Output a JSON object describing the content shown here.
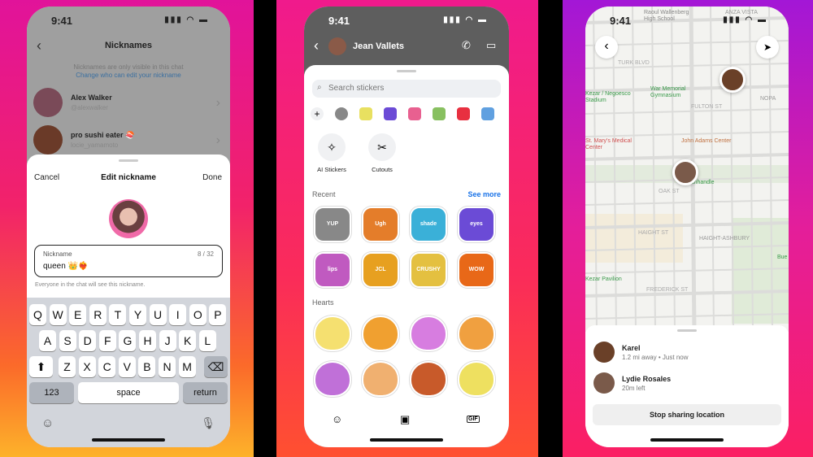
{
  "status": {
    "time": "9:41"
  },
  "nicknames": {
    "title": "Nicknames",
    "info_line": "Nicknames are only visible in this chat",
    "info_link": "Change who can edit your nickname",
    "people": [
      {
        "name": "Alex Walker",
        "handle": "@alexwalker"
      },
      {
        "name": "pro sushi eater 🍣",
        "handle": "locie_yamamoto"
      }
    ],
    "sheet": {
      "cancel": "Cancel",
      "title": "Edit nickname",
      "done": "Done",
      "field_label": "Nickname",
      "counter": "8 / 32",
      "value": "queen 👑❤️‍🔥",
      "hint": "Everyone in the chat will see this nickname."
    },
    "keyboard": {
      "row1": [
        "Q",
        "W",
        "E",
        "R",
        "T",
        "Y",
        "U",
        "I",
        "O",
        "P"
      ],
      "row2": [
        "A",
        "S",
        "D",
        "F",
        "G",
        "H",
        "J",
        "K",
        "L"
      ],
      "row3": [
        "Z",
        "X",
        "C",
        "V",
        "B",
        "N",
        "M"
      ],
      "num": "123",
      "space": "space",
      "return": "return"
    }
  },
  "chat": {
    "contact": "Jean Vallets",
    "search_placeholder": "Search stickers",
    "ai_stickers": "AI Stickers",
    "cutouts": "Cutouts",
    "recent": "Recent",
    "see_more": "See more",
    "hearts": "Hearts",
    "recent_stickers": [
      "YUP",
      "Ugh",
      "shade",
      "eyes",
      "lips",
      "JCL",
      "CRUSHY BUT CARING",
      "WOW"
    ],
    "recent_colors": [
      "#888",
      "#e47d2a",
      "#3ab0d8",
      "#6b4bd6",
      "#c05ac0",
      "#e7a020",
      "#e4c040",
      "#e86818"
    ],
    "heart_colors": [
      "#f5e070",
      "#f0a030",
      "#d77de0",
      "#f0a040",
      "#c070d8",
      "#f0b070",
      "#c85a2a",
      "#eee060"
    ],
    "tray_icons": [
      "avatar-icon",
      "sticker-icon",
      "gif-icon"
    ],
    "gif": "GIF"
  },
  "map": {
    "labels": [
      "Raoul Wallenberg High School",
      "ANZA VISTA",
      "TURK BLVD",
      "War Memorial Gymnasium",
      "Kezar / Negoesco Stadium",
      "NOPA",
      "FULTON ST",
      "St. Mary's Medical Center",
      "John Adams Center",
      "Panhandle",
      "OAK ST",
      "HAIGHT-ASHBURY",
      "HAIGHT ST",
      "Kezar Pavilion",
      "FREDERICK ST",
      "Bue"
    ],
    "people": [
      {
        "name": "Karel",
        "detail": "1.2 mi away • Just now"
      },
      {
        "name": "Lydie Rosales",
        "detail": "20m left"
      }
    ],
    "stop_button": "Stop sharing location"
  }
}
